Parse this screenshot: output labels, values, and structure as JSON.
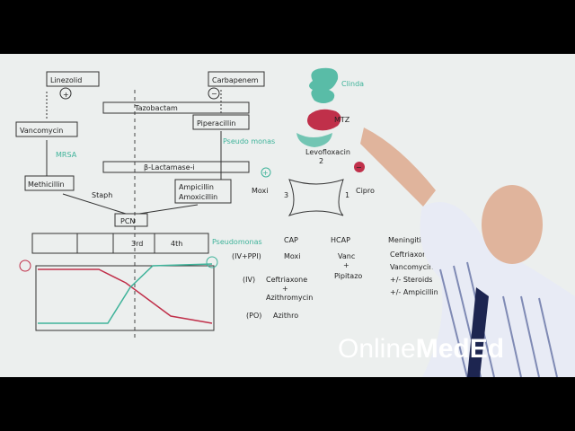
{
  "board": {
    "drugs": {
      "linezolid": "Linezolid",
      "carbapenem": "Carbapenem",
      "tazobactam": "Tazobactam",
      "vancomycin": "Vancomycin",
      "piperacillin": "Piperacillin",
      "pseudomonas": "Pseudo monas",
      "mrsa": "MRSA",
      "methicillin": "Methicillin",
      "b_lactamase": "β-Lactamase-i",
      "staph": "Staph",
      "ampicillin": "Ampicillin",
      "amoxicillin": "Amoxicillin",
      "pcn": "PCN",
      "plus": "+",
      "minus": "−"
    },
    "generations": {
      "third": "3rd",
      "fourth": "4th",
      "pseudomonas": "Pseudomonas",
      "ivppi": "(IV+PPI)"
    },
    "diagram": {
      "clinda": "Clinda",
      "mtz": "MTZ",
      "levofloxacin": "Levofloxacin",
      "two": "2",
      "moxi": "Moxi",
      "three": "3",
      "one": "1",
      "cipro": "Cipro",
      "plus": "+",
      "minus": "−"
    },
    "table": {
      "cap": {
        "header": "CAP",
        "moxi": "Moxi",
        "iv": "(IV)",
        "ceftriaxone": "Ceftriaxone",
        "plus": "+",
        "azithromycin": "Azithromycin",
        "po": "(PO)",
        "azithro": "Azithro"
      },
      "hcap": {
        "header": "HCAP",
        "vanc": "Vanc",
        "plus": "+",
        "pipitazo": "Pipitazo"
      },
      "meningitis": {
        "header": "Meningitis",
        "ceftriaxone": "Ceftriaxone",
        "vancomycin": "Vancomycin",
        "steroids": "+/- Steroids",
        "ampicillin": "+/- Ampicillin"
      }
    }
  },
  "watermark": {
    "online": "Online",
    "med": "Med",
    "ed": "Ed"
  },
  "colors": {
    "teal": "#3fb39a",
    "red": "#c0304a",
    "board": "#ecefee"
  }
}
